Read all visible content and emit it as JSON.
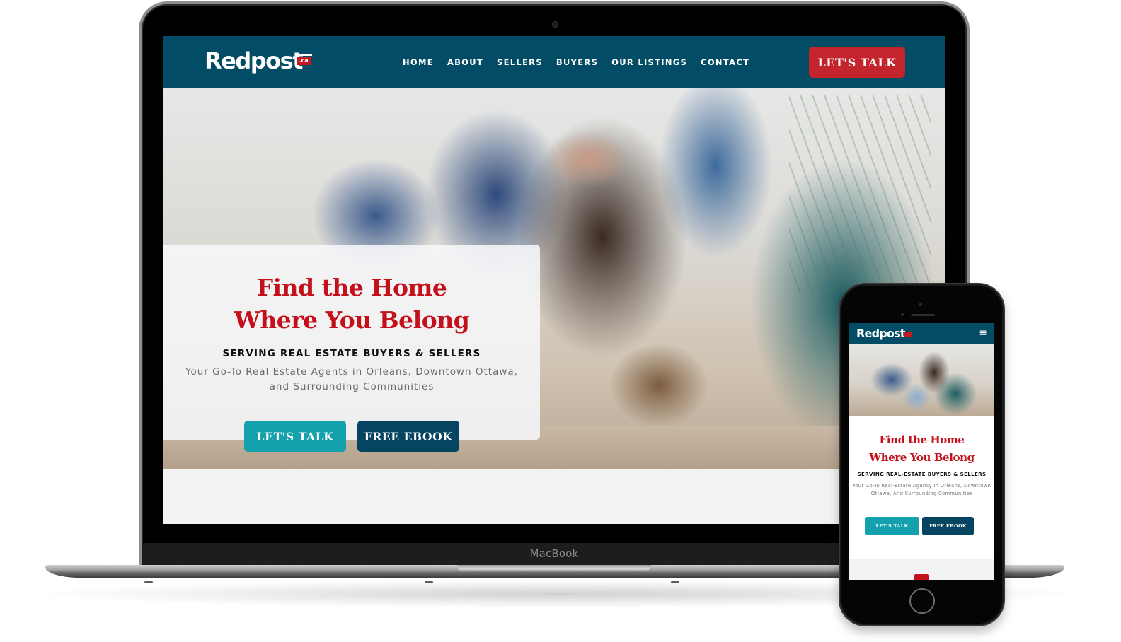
{
  "device_labels": {
    "laptop": "MacBook"
  },
  "desktop": {
    "logo": {
      "text": "Redpost",
      "tld": ".ca"
    },
    "nav": {
      "links": [
        "HOME",
        "ABOUT",
        "SELLERS",
        "BUYERS",
        "OUR LISTINGS",
        "CONTACT"
      ],
      "cta": "LET'S TALK"
    },
    "hero": {
      "title_line1": "Find the Home",
      "title_line2": "Where You Belong",
      "subtitle": "SERVING REAL ESTATE BUYERS & SELLERS",
      "description": "Your Go-To Real Estate Agents in Orleans, Downtown Ottawa, and Surrounding Communities",
      "buttons": {
        "talk": "LET'S TALK",
        "ebook": "FREE EBOOK"
      }
    }
  },
  "mobile": {
    "logo": {
      "text": "Redpost",
      "tld": ".ca"
    },
    "menu_icon": "≡",
    "hero": {
      "title_line1": "Find the Home",
      "title_line2": "Where You Belong",
      "subtitle": "SERVING REAL-ESTATE BUYERS & SELLERS",
      "description": "Your Go-To Real-Estate Agency In Orleans, Downtown Ottawa, And Surrounding Communities",
      "buttons": {
        "talk": "LET'S TALK",
        "ebook": "FREE EBOOK"
      }
    }
  },
  "colors": {
    "nav_bg": "#034c66",
    "brand_red": "#c4252d",
    "title_red": "#c4101a",
    "teal": "#15a0ad",
    "navy": "#064561"
  }
}
